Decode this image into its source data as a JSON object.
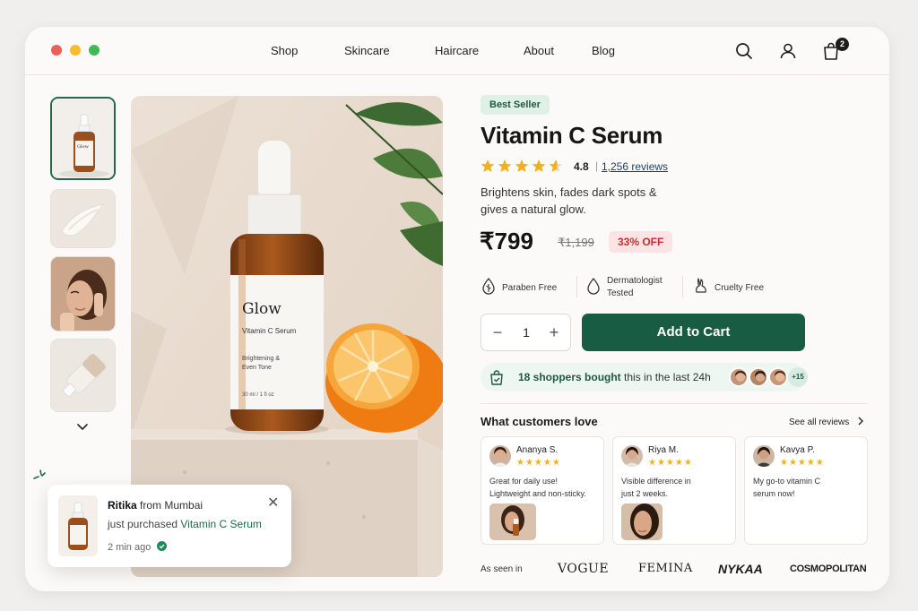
{
  "window": {
    "dot_colors": [
      "#ee5f57",
      "#f5bd2f",
      "#3fba56"
    ]
  },
  "nav": {
    "items": [
      "Shop",
      "Skincare",
      "Haircare",
      "About",
      "Blog"
    ],
    "cart_count": "2",
    "icons": [
      "search-icon",
      "user-icon",
      "shopping-bag-icon"
    ]
  },
  "gallery": {
    "hero_bottle_brand": "Glow",
    "hero_bottle_product": "Vitamin C Serum",
    "hero_bottle_benefit_1": "Brightening &",
    "hero_bottle_benefit_2": "Even Tone",
    "hero_bottle_size": "30 ml / 1 fl oz",
    "thumb_bottle_brand": "Glow",
    "thumbnails_scroll_icon": "chevron-down-icon"
  },
  "product": {
    "badge": "Best Seller",
    "title": "Vitamin C Serum",
    "rating": "4.8",
    "rating_value": 4.8,
    "separator": "|",
    "reviews_link": "1,256 reviews",
    "description": "Brightens skin, fades dark spots & gives a natural glow.",
    "price": "₹799",
    "mrp": "₹1,199",
    "discount": "33% OFF",
    "features": [
      {
        "label": "Paraben Free",
        "icon": "leaf-drop-icon"
      },
      {
        "label_line1": "Dermatologist",
        "label_line2": "Tested",
        "icon": "drop-icon"
      },
      {
        "label": "Cruelty Free",
        "icon": "rabbit-icon"
      }
    ],
    "quantity": "1",
    "quantity_minus": "−",
    "quantity_plus": "+",
    "add_to_cart": "Add to Cart"
  },
  "social_proof": {
    "count_text": "18 shoppers bought",
    "rest_text": " this in the last 24h",
    "more_count": "+15"
  },
  "reviews": {
    "heading": "What customers love",
    "see_all": "See all reviews",
    "items": [
      {
        "name": "Ananya S.",
        "stars": "★★★★★",
        "line1": "Great for daily use!",
        "line2": "Lightweight and non-sticky."
      },
      {
        "name": "Riya M.",
        "stars": "★★★★★",
        "line1": "Visible difference in",
        "line2": "just 2 weeks."
      },
      {
        "name": "Kavya P.",
        "stars": "★★★★★",
        "line1": "My go-to vitamin C",
        "line2": "serum now!"
      }
    ]
  },
  "as_seen_in": {
    "label": "As seen in",
    "logos": [
      "VOGUE",
      "FEMINA",
      "NYKAA",
      "COSMOPOLITAN"
    ]
  },
  "toast": {
    "name": "Ritika",
    "location": " from Mumbai",
    "line2_prefix": "just purchased ",
    "product": "Vitamin C Serum",
    "time": "2 min ago",
    "close": "✕"
  },
  "colors": {
    "accent": "#185c43",
    "badge_bg": "#dff0e6",
    "discount": "#c92d2d",
    "star": "#f2b01e"
  }
}
